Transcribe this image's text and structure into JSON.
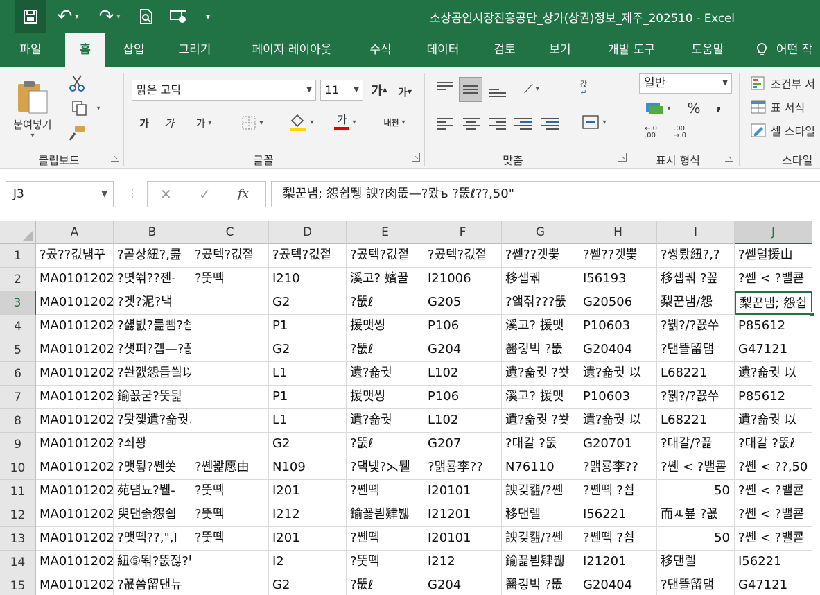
{
  "app": {
    "title": "소상공인시장진흥공단_상가(상권)정보_제주_202510  -  Excel",
    "qat": {
      "save": "save-icon",
      "undo": "undo-icon",
      "redo": "redo-icon",
      "preview": "print-preview-icon",
      "touch": "touch-mode-icon",
      "more": "▾"
    }
  },
  "tabs": [
    {
      "label": "파일"
    },
    {
      "label": "홈"
    },
    {
      "label": "삽입"
    },
    {
      "label": "그리기"
    },
    {
      "label": "페이지 레이아웃"
    },
    {
      "label": "수식"
    },
    {
      "label": "데이터"
    },
    {
      "label": "검토"
    },
    {
      "label": "보기"
    },
    {
      "label": "개발 도구"
    },
    {
      "label": "도움말"
    },
    {
      "label": "어떤 작"
    }
  ],
  "ribbon": {
    "clipboard": {
      "label": "클립보드",
      "paste": "붙여넣기"
    },
    "font": {
      "label": "글꼴",
      "name": "맑은 고딕",
      "size": "11",
      "grow": "가",
      "shrink": "가",
      "bold": "가",
      "italic": "가",
      "underline": "가",
      "font_color": "가",
      "phonetic": "내천"
    },
    "alignment": {
      "label": "맞춤",
      "wrap": "갅"
    },
    "number": {
      "label": "표시 형식",
      "format": "일반",
      "percent": "%",
      "comma": ","
    },
    "styles": {
      "label": "스타일",
      "conditional": "조건부 서",
      "table": "표 서식",
      "cell": "셀 스타일"
    }
  },
  "formula_bar": {
    "name_box": "J3",
    "cancel": "✕",
    "enter": "✓",
    "fx": "fx",
    "content": "梨꾼냄; 怨쉽뛩 諛?肉뚮—?뫘ъ ?뚮ℓ??,50\""
  },
  "grid": {
    "columns": [
      "A",
      "B",
      "C",
      "D",
      "E",
      "F",
      "G",
      "H",
      "I",
      "J"
    ],
    "selected_column": "J",
    "selected_row": 3,
    "rows": [
      {
        "n": "1",
        "cells": [
          "?곴??깂냼꾸",
          "?곧상紐?,콢",
          "?곴텍?깂젙",
          "?곴텍?깂젙",
          "?곴텍?깂젙",
          "?곴텍?깂젙",
          "?쎋??겟뿣",
          "?쎋??겟뿣",
          "?쎵뢌紐?,?",
          "?쎋뎔援山"
        ]
      },
      {
        "n": "2",
        "cells": [
          "MA0101202",
          "?몃쒺??젠-",
          "?뚯뗵",
          "I210",
          "溪고? 嬪꿀",
          "I21006",
          "移샙궦",
          "I56193",
          "移샙궦 ?꽆",
          "?쎋 < ?밸쿋"
        ]
      },
      {
        "n": "3",
        "cells": [
          "MA0101202",
          "?겟?泥?낵",
          "",
          "G2",
          "?뚮ℓ",
          "G205",
          "?앸짂???뚮",
          "G20506",
          "梨꾼냄/怨",
          "梨꾼냄; 怨쉽"
        ]
      },
      {
        "n": "4",
        "cells": [
          "MA0101202",
          "?섏빐?릂뺌?쇰뚮",
          "",
          "P1",
          "援맷씽",
          "P106",
          "溪고? 援맷",
          "P10603",
          "?뷁?/?꾮쑤",
          "P85612"
        ]
      },
      {
        "n": "5",
        "cells": [
          "MA0101202",
          "?샛퍼?곕—?꾮퉶留댄",
          "",
          "G2",
          "?뚮ℓ",
          "G204",
          "醫깋빅 ?뚮",
          "G20404",
          "?댄뜰留댐",
          "G47121"
        ]
      },
      {
        "n": "6",
        "cells": [
          "MA0101202",
          "?쏸꺬怨듭씤以뫎컺?ㅑ",
          "",
          "L1",
          "遺?숇궛",
          "L102",
          "遺?숇궛 ?쐇",
          "遺?숇궛 以",
          "L68221",
          "遺?숇궛 以"
        ]
      },
      {
        "n": "7",
        "cells": [
          "MA0101202",
          "鍮꾮굳?뚯딅",
          "",
          "P1",
          "援맷씽",
          "P106",
          "溪고? 援맷",
          "P10603",
          "?뷁?/?꾮쑤",
          "P85612"
        ]
      },
      {
        "n": "8",
        "cells": [
          "MA0101202",
          "?뫗쟻遺?숇궛以뫎컺",
          "",
          "L1",
          "遺?숇궛",
          "L102",
          "遺?숇궛 ?쐇",
          "遺?숇궛 以",
          "L68221",
          "遺?숇궛 以"
        ]
      },
      {
        "n": "9",
        "cells": [
          "MA0101202",
          "?쇠꽝",
          "",
          "G2",
          "?뚮ℓ",
          "G207",
          "?대갈 ?뚮",
          "G20701",
          "?대갈/?꾩",
          "?대갈 ?뚮ℓ"
        ]
      },
      {
        "n": "10",
        "cells": [
          "MA0101202",
          "?맷뒿?쏀쏫",
          "?쏀꽕愿由",
          "N109",
          "?댁넻?⋋퉬",
          "?맭룡李??",
          "N76110",
          "?맭룡李??",
          "?쏀 < ?밸쿋",
          "?쏀 < ??,50"
        ]
      },
      {
        "n": "11",
        "cells": [
          "MA0101202",
          "苑덈뇨?뷀-",
          "?뚯뗵",
          "I201",
          "?쏀뗵",
          "I20101",
          "諛깆컖/?쏀",
          "?쏀뗵 ?쇰",
          "50",
          "?쏀 < ?밸쿋"
        ]
      },
      {
        "n": "12",
        "cells": [
          "MA0101202",
          "臾댄솕怨쇱",
          "?뚯뗵",
          "I212",
          "鍮꾩븯肄붾",
          "I21201",
          "移댄렐",
          "I56221",
          "而ㅻ뵾 ?꾮",
          "?쏀 < ?밸쿋"
        ]
      },
      {
        "n": "13",
        "cells": [
          "MA0101202",
          "?맷뗵??,\",I",
          "?뚯뗵",
          "I201",
          "?쏀뗵",
          "I20101",
          "諛깆컖/?쏀",
          "?쏀뗵 ?쇰",
          "50",
          "?쏀 < ?밸쿋"
        ]
      },
      {
        "n": "14",
        "cells": [
          "MA0101202",
          "紐⑤뙦?뚮젆?댁뒿",
          "",
          "I2",
          "?뚯뗵",
          "I212",
          "鍮꾩븯肄붾",
          "I21201",
          "移댄렐",
          "I56221"
        ]
      },
      {
        "n": "15",
        "cells": [
          "MA0101202",
          "?꾮씀留댄뉴",
          "",
          "G2",
          "?뚮ℓ",
          "G204",
          "醫깋빅 ?뚮",
          "G20404",
          "?댄뜰留댐",
          "G47121"
        ]
      }
    ]
  }
}
